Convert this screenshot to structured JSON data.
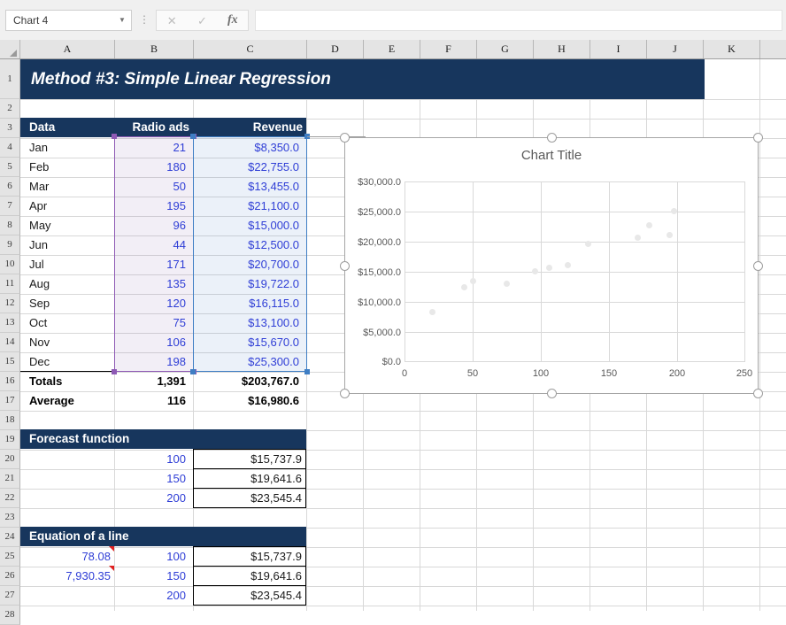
{
  "formula_bar": {
    "name_box_value": "Chart 4",
    "name_box_dropdown_icon": "chevron-down-icon",
    "more_icon": "vertical-dots-icon",
    "cancel_icon": "✕",
    "confirm_icon": "✓",
    "function_icon": "fx",
    "formula_value": ""
  },
  "grid": {
    "column_headers": [
      "A",
      "B",
      "C",
      "D",
      "E",
      "F",
      "G",
      "H",
      "I",
      "J",
      "K"
    ],
    "row_headers": [
      "1",
      "2",
      "3",
      "4",
      "5",
      "6",
      "7",
      "8",
      "9",
      "10",
      "11",
      "12",
      "13",
      "14",
      "15",
      "16",
      "17",
      "18",
      "19",
      "20",
      "21",
      "22",
      "23",
      "24",
      "25",
      "26",
      "27",
      "28"
    ]
  },
  "sheet": {
    "title": "Method #3: Simple Linear Regression",
    "table_headers": {
      "label": "Data",
      "radio_ads": "Radio ads",
      "revenue": "Revenue"
    },
    "rows": [
      {
        "month": "Jan",
        "ads": "21",
        "revenue": "$8,350.0"
      },
      {
        "month": "Feb",
        "ads": "180",
        "revenue": "$22,755.0"
      },
      {
        "month": "Mar",
        "ads": "50",
        "revenue": "$13,455.0"
      },
      {
        "month": "Apr",
        "ads": "195",
        "revenue": "$21,100.0"
      },
      {
        "month": "May",
        "ads": "96",
        "revenue": "$15,000.0"
      },
      {
        "month": "Jun",
        "ads": "44",
        "revenue": "$12,500.0"
      },
      {
        "month": "Jul",
        "ads": "171",
        "revenue": "$20,700.0"
      },
      {
        "month": "Aug",
        "ads": "135",
        "revenue": "$19,722.0"
      },
      {
        "month": "Sep",
        "ads": "120",
        "revenue": "$16,115.0"
      },
      {
        "month": "Oct",
        "ads": "75",
        "revenue": "$13,100.0"
      },
      {
        "month": "Nov",
        "ads": "106",
        "revenue": "$15,670.0"
      },
      {
        "month": "Dec",
        "ads": "198",
        "revenue": "$25,300.0"
      }
    ],
    "totals": {
      "label": "Totals",
      "ads": "1,391",
      "revenue": "$203,767.0"
    },
    "average": {
      "label": "Average",
      "ads": "116",
      "revenue": "$16,980.6"
    },
    "forecast": {
      "title": "Forecast function",
      "rows": [
        {
          "x": "100",
          "y": "$15,737.9"
        },
        {
          "x": "150",
          "y": "$19,641.6"
        },
        {
          "x": "200",
          "y": "$23,545.4"
        }
      ]
    },
    "equation": {
      "title": "Equation of a line",
      "slope": "78.08",
      "intercept": "7,930.35",
      "rows": [
        {
          "x": "100",
          "y": "$15,737.9"
        },
        {
          "x": "150",
          "y": "$19,641.6"
        },
        {
          "x": "200",
          "y": "$23,545.4"
        }
      ]
    }
  },
  "chart_data": {
    "type": "scatter",
    "title": "Chart Title",
    "xlabel": "",
    "ylabel": "",
    "xlim": [
      0,
      250
    ],
    "ylim": [
      0,
      30000
    ],
    "xticks": [
      "0",
      "50",
      "100",
      "150",
      "200",
      "250"
    ],
    "yticks": [
      "$0.0",
      "$5,000.0",
      "$10,000.0",
      "$15,000.0",
      "$20,000.0",
      "$25,000.0",
      "$30,000.0"
    ],
    "grid": true,
    "legend": false,
    "marker_color": "#e8e8e8",
    "series": [
      {
        "name": "Revenue",
        "points": [
          {
            "x": 21,
            "y": 8350
          },
          {
            "x": 180,
            "y": 22755
          },
          {
            "x": 50,
            "y": 13455
          },
          {
            "x": 195,
            "y": 21100
          },
          {
            "x": 96,
            "y": 15000
          },
          {
            "x": 44,
            "y": 12500
          },
          {
            "x": 171,
            "y": 20700
          },
          {
            "x": 135,
            "y": 19722
          },
          {
            "x": 120,
            "y": 16115
          },
          {
            "x": 75,
            "y": 13100
          },
          {
            "x": 106,
            "y": 15670
          },
          {
            "x": 198,
            "y": 25300
          }
        ]
      }
    ]
  },
  "colors": {
    "header_navy": "#17365d",
    "selection_purple": "#8e5ab5",
    "selection_blue": "#3f7ec4",
    "number_blue": "#2f3ed6"
  }
}
